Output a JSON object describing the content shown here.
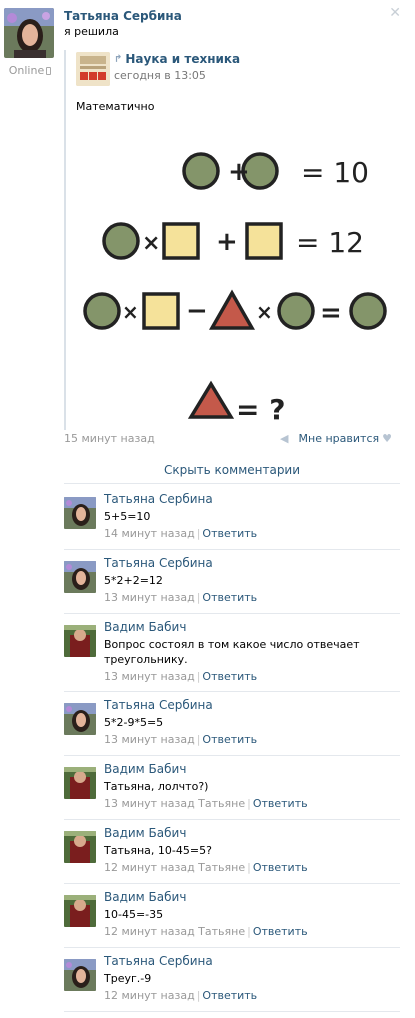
{
  "post": {
    "author": "Татьяна Сербина",
    "status": "Online",
    "text": "я решила",
    "close": "✕",
    "repost": {
      "group": "Наука и техника",
      "date": "сегодня в 13:05",
      "text": "Математично",
      "puzzle": {
        "row1_result": "= 10",
        "row2_result": "= 12",
        "row4": "= ?",
        "op_plus": "+",
        "op_times": "×",
        "op_minus": "−",
        "op_equals": "="
      }
    },
    "time": "15 минут назад",
    "like_label": "Мне нравится"
  },
  "hide_comments": "Скрыть комментарии",
  "comments": [
    {
      "author": "Татьяна Сербина",
      "text": "5+5=10",
      "time": "14 минут назад",
      "reply": "Ответить"
    },
    {
      "author": "Татьяна Сербина",
      "text": "5*2+2=12",
      "time": "13 минут назад",
      "reply": "Ответить"
    },
    {
      "author": "Вадим Бабич",
      "text": "Вопрос состоял в том какое число отвечает треугольнику.",
      "time": "13 минут назад",
      "reply": "Ответить"
    },
    {
      "author": "Татьяна Сербина",
      "text": "5*2-9*5=5",
      "time": "13 минут назад",
      "reply": "Ответить"
    },
    {
      "author": "Вадим Бабич",
      "text": "Татьяна, лолчто?)",
      "time": "13 минут назад Татьяне",
      "reply": "Ответить"
    },
    {
      "author": "Вадим Бабич",
      "text": "Татьяна, 10-45=5?",
      "time": "12 минут назад Татьяне",
      "reply": "Ответить"
    },
    {
      "author": "Вадим Бабич",
      "text": "10-45=-35",
      "time": "12 минут назад Татьяне",
      "reply": "Ответить"
    },
    {
      "author": "Татьяна Сербина",
      "text": "Треуг.-9",
      "time": "12 минут назад",
      "reply": "Ответить"
    }
  ]
}
